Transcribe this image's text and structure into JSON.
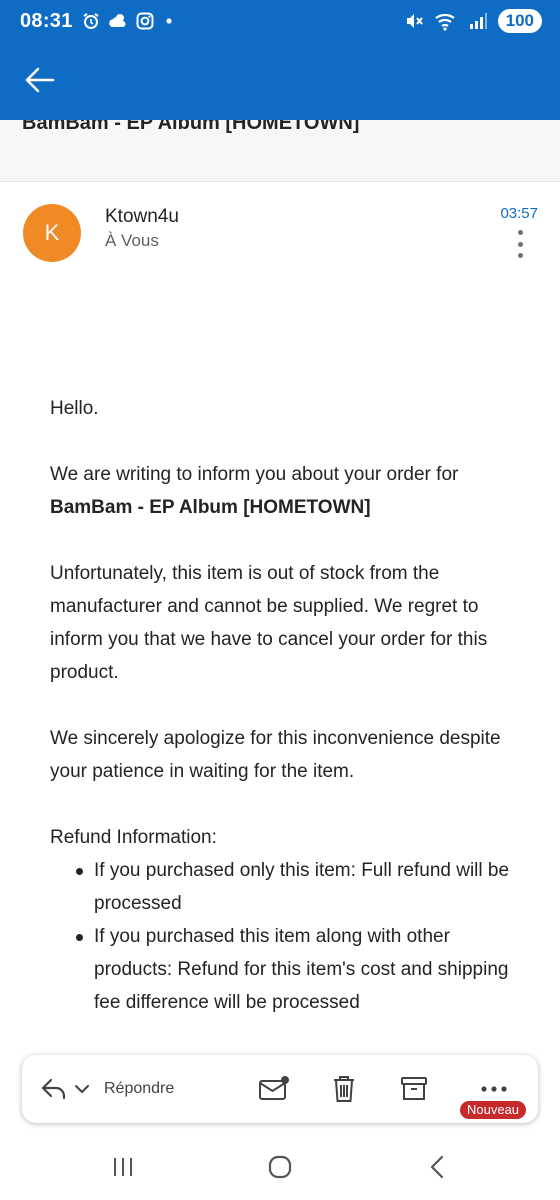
{
  "status_bar": {
    "time": "08:31",
    "battery": "100",
    "left_icons": [
      "alarm-icon",
      "weather-icon",
      "instagram-icon",
      "dot-icon"
    ],
    "right_icons": [
      "mute-icon",
      "wifi-icon",
      "signal-icon"
    ]
  },
  "app_bar": {
    "color": "#0f6cc4",
    "back_icon": "back-arrow-icon"
  },
  "email": {
    "subject": "BamBam - EP Album [HOMETOWN]",
    "sender_initial": "K",
    "sender": "Ktown4u",
    "recipient": "À Vous",
    "time": "03:57",
    "avatar_color": "#f08a24",
    "body": {
      "greeting": "Hello.",
      "intro": "We are writing to inform you about your order for",
      "product": "BamBam - EP Album [HOMETOWN]",
      "paragraph2": "Unfortunately, this item is out of stock from the manufacturer and cannot be supplied. We regret to inform you that we have to cancel your order for this product.",
      "paragraph3": "We sincerely apologize for this inconvenience despite your patience in waiting for the item.",
      "refund_title": "Refund Information:",
      "refund_items": [
        "If you purchased only this item: Full refund will be processed",
        "If you purchased this item along with other products: Refund for this item's cost and shipping fee difference will be processed"
      ]
    }
  },
  "actions": {
    "reply_label": "Répondre",
    "new_badge": "Nouveau",
    "icons": [
      "reply-icon",
      "chevron-down-icon",
      "mail-unread-icon",
      "trash-icon",
      "archive-icon",
      "more-horizontal-icon"
    ]
  },
  "nav": {
    "icons": [
      "recents-icon",
      "home-icon",
      "back-icon"
    ]
  }
}
